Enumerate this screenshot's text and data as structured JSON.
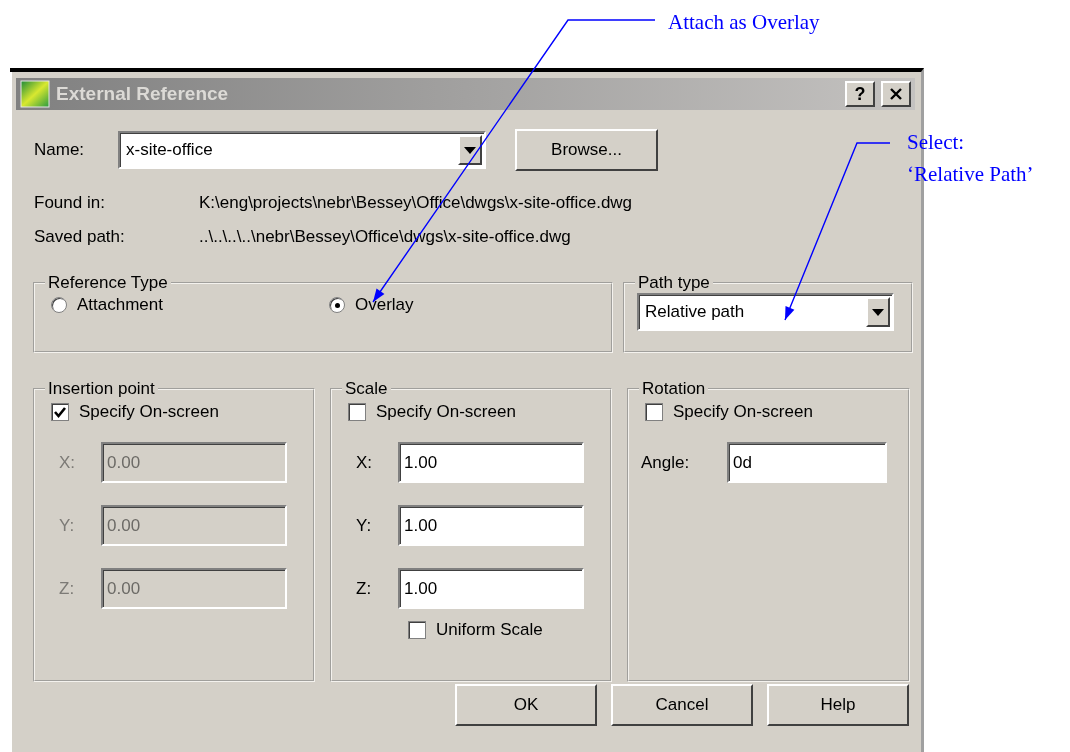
{
  "annotations": [
    {
      "kind": "overlay-note",
      "lines": [
        "Attach as Overlay"
      ]
    },
    {
      "kind": "path-note",
      "lines": [
        "Select:",
        "‘Relative Path’"
      ]
    }
  ],
  "dialog": {
    "title": "External Reference",
    "help_button": "?",
    "name": {
      "label": "Name:",
      "value": "x-site-office"
    },
    "browse_button": "Browse...",
    "found_in": {
      "label": "Found in:",
      "value": "K:\\eng\\projects\\nebr\\Bessey\\Office\\dwgs\\x-site-office.dwg"
    },
    "saved_path": {
      "label": "Saved path:",
      "value": "..\\..\\..\\..\\nebr\\Bessey\\Office\\dwgs\\x-site-office.dwg"
    },
    "reference_type": {
      "legend": "Reference Type",
      "options": [
        {
          "label": "Attachment",
          "selected": false
        },
        {
          "label": "Overlay",
          "selected": true
        }
      ]
    },
    "path_type": {
      "legend": "Path type",
      "value": "Relative path"
    },
    "insertion_point": {
      "legend": "Insertion point",
      "specify_on_screen": {
        "label": "Specify On-screen",
        "checked": true
      },
      "fields": [
        {
          "label": "X:",
          "value": "0.00",
          "disabled": true
        },
        {
          "label": "Y:",
          "value": "0.00",
          "disabled": true
        },
        {
          "label": "Z:",
          "value": "0.00",
          "disabled": true
        }
      ]
    },
    "scale": {
      "legend": "Scale",
      "specify_on_screen": {
        "label": "Specify On-screen",
        "checked": false
      },
      "fields": [
        {
          "label": "X:",
          "value": "1.00",
          "disabled": false
        },
        {
          "label": "Y:",
          "value": "1.00",
          "disabled": false
        },
        {
          "label": "Z:",
          "value": "1.00",
          "disabled": false
        }
      ],
      "uniform_scale": {
        "label": "Uniform Scale",
        "checked": false
      }
    },
    "rotation": {
      "legend": "Rotation",
      "specify_on_screen": {
        "label": "Specify On-screen",
        "checked": false
      },
      "angle": {
        "label": "Angle:",
        "value": "0d"
      }
    },
    "buttons": [
      "OK",
      "Cancel",
      "Help"
    ]
  }
}
